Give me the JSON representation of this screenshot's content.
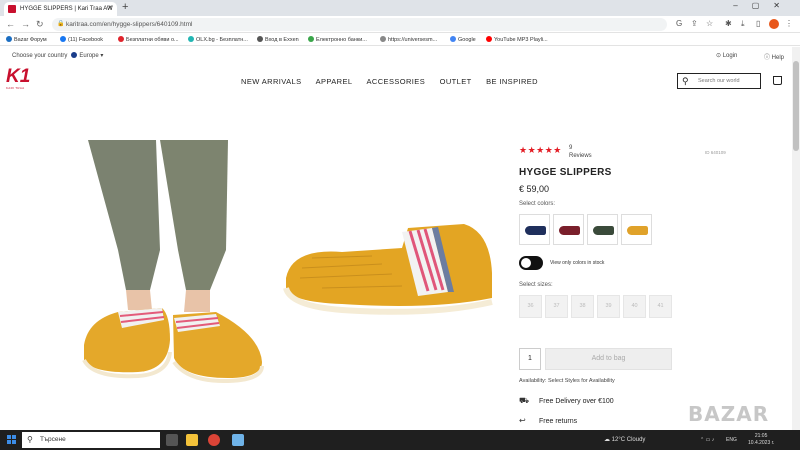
{
  "browser": {
    "tab_title": "HYGGE SLIPPERS | Kari Traa AW",
    "url": "karitraa.com/en/hygge-slippers/640109.html",
    "bookmarks": [
      "Bazar Форум",
      "(11) Facebook",
      "Безплатни обяви о...",
      "OLX.bg - Безплатн...",
      "Вход в Exxen",
      "Електронно банки...",
      "https://universesm...",
      "Google",
      "YouTube MP3 Playli..."
    ]
  },
  "site": {
    "country_label": "Choose your country",
    "country_value": "Europe",
    "login": "Login",
    "help": "Help",
    "logo_text": "K1",
    "logo_sub": "KARI TRAA",
    "nav": [
      "NEW ARRIVALS",
      "APPAREL",
      "ACCESSORIES",
      "OUTLET",
      "BE INSPIRED"
    ],
    "search_placeholder": "Search our world"
  },
  "product": {
    "rating_stars": "★★★★★",
    "review_count": "9",
    "reviews_label": "Reviews",
    "product_id": "ID 640109",
    "title": "HYGGE SLIPPERS",
    "price": "€ 59,00",
    "select_colors_label": "Select colors:",
    "colors": [
      "#1f2f5c",
      "#7a1f2b",
      "#3a4a3a",
      "#e0a22a"
    ],
    "toggle_label": "View only colors in stock",
    "select_sizes_label": "Select sizes:",
    "sizes": [
      "36",
      "37",
      "38",
      "39",
      "40",
      "41"
    ],
    "quantity": "1",
    "add_to_bag": "Add to bag",
    "availability": "Availability:  Select Styles for Availability",
    "delivery": "Free Delivery over €100",
    "returns": "Free returns"
  },
  "watermark": "BAZAR",
  "taskbar": {
    "search_text": "Търсене",
    "weather": "12°C  Cloudy",
    "lang": "ENG",
    "time": "21:05",
    "date": "10.4.2023 г."
  }
}
